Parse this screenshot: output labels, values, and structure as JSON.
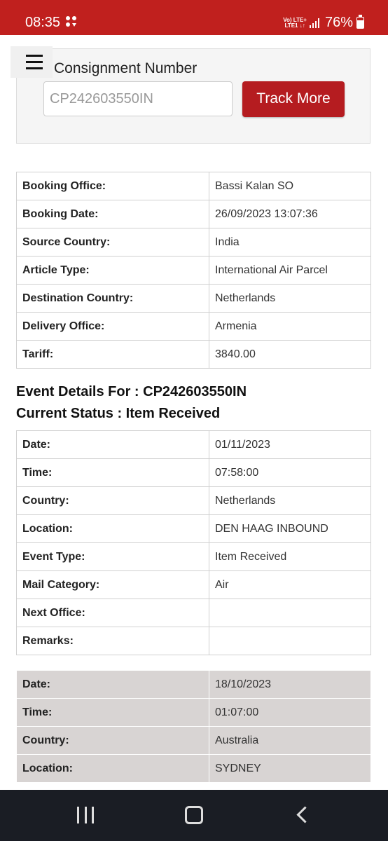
{
  "status_bar": {
    "time": "08:35",
    "net_top": "Vo) LTE+",
    "net_bottom": "LTE1 ↓↑",
    "battery": "76%"
  },
  "search": {
    "label": "Consignment Number",
    "input_value": "CP242603550IN",
    "button": "Track More"
  },
  "booking": [
    {
      "k": "Booking Office:",
      "v": "Bassi Kalan SO"
    },
    {
      "k": "Booking Date:",
      "v": "26/09/2023 13:07:36"
    },
    {
      "k": "Source Country:",
      "v": "India"
    },
    {
      "k": "Article Type:",
      "v": "International Air Parcel"
    },
    {
      "k": "Destination Country:",
      "v": "Netherlands"
    },
    {
      "k": "Delivery Office:",
      "v": "Armenia"
    },
    {
      "k": "Tariff:",
      "v": "3840.00"
    }
  ],
  "event_heading": "Event Details For : CP242603550IN",
  "status_heading": "Current Status : Item Received",
  "event1": [
    {
      "k": "Date:",
      "v": "01/11/2023"
    },
    {
      "k": "Time:",
      "v": "07:58:00"
    },
    {
      "k": "Country:",
      "v": "Netherlands"
    },
    {
      "k": "Location:",
      "v": "DEN HAAG INBOUND"
    },
    {
      "k": "Event Type:",
      "v": "Item Received"
    },
    {
      "k": "Mail Category:",
      "v": "Air"
    },
    {
      "k": "Next Office:",
      "v": ""
    },
    {
      "k": "Remarks:",
      "v": ""
    }
  ],
  "event2": [
    {
      "k": "Date:",
      "v": "18/10/2023"
    },
    {
      "k": "Time:",
      "v": "01:07:00"
    },
    {
      "k": "Country:",
      "v": "Australia"
    },
    {
      "k": "Location:",
      "v": "SYDNEY"
    }
  ]
}
